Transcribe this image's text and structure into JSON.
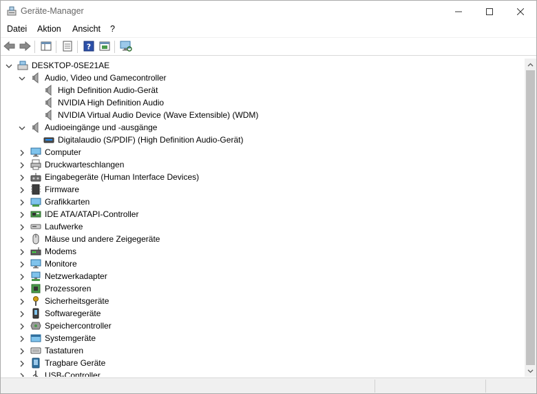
{
  "window": {
    "title": "Geräte-Manager"
  },
  "menu": {
    "items": [
      "Datei",
      "Aktion",
      "Ansicht",
      "?"
    ]
  },
  "toolbar": {
    "buttons": [
      "back-arrow-icon",
      "forward-arrow-icon",
      "show-hide-tree-icon",
      "properties-icon",
      "help-icon",
      "update-driver-icon",
      "scan-hardware-icon"
    ]
  },
  "tree": {
    "root": "DESKTOP-0SE21AE",
    "audio_group": {
      "label": "Audio, Video und Gamecontroller",
      "children": [
        "High Definition Audio-Gerät",
        "NVIDIA High Definition Audio",
        "NVIDIA Virtual Audio Device (Wave Extensible) (WDM)"
      ]
    },
    "audio_io_group": {
      "label": "Audioeingänge und -ausgänge",
      "children": [
        "Digitalaudio (S/PDIF) (High Definition Audio-Gerät)"
      ]
    },
    "categories": [
      "Computer",
      "Druckwarteschlangen",
      "Eingabegeräte (Human Interface Devices)",
      "Firmware",
      "Grafikkarten",
      "IDE ATA/ATAPI-Controller",
      "Laufwerke",
      "Mäuse und andere Zeigegeräte",
      "Modems",
      "Monitore",
      "Netzwerkadapter",
      "Prozessoren",
      "Sicherheitsgeräte",
      "Softwaregeräte",
      "Speichercontroller",
      "Systemgeräte",
      "Tastaturen",
      "Tragbare Geräte",
      "USB-Controller"
    ]
  },
  "colors": {
    "accent": "#0078d7",
    "selection": "#cce8ff"
  }
}
